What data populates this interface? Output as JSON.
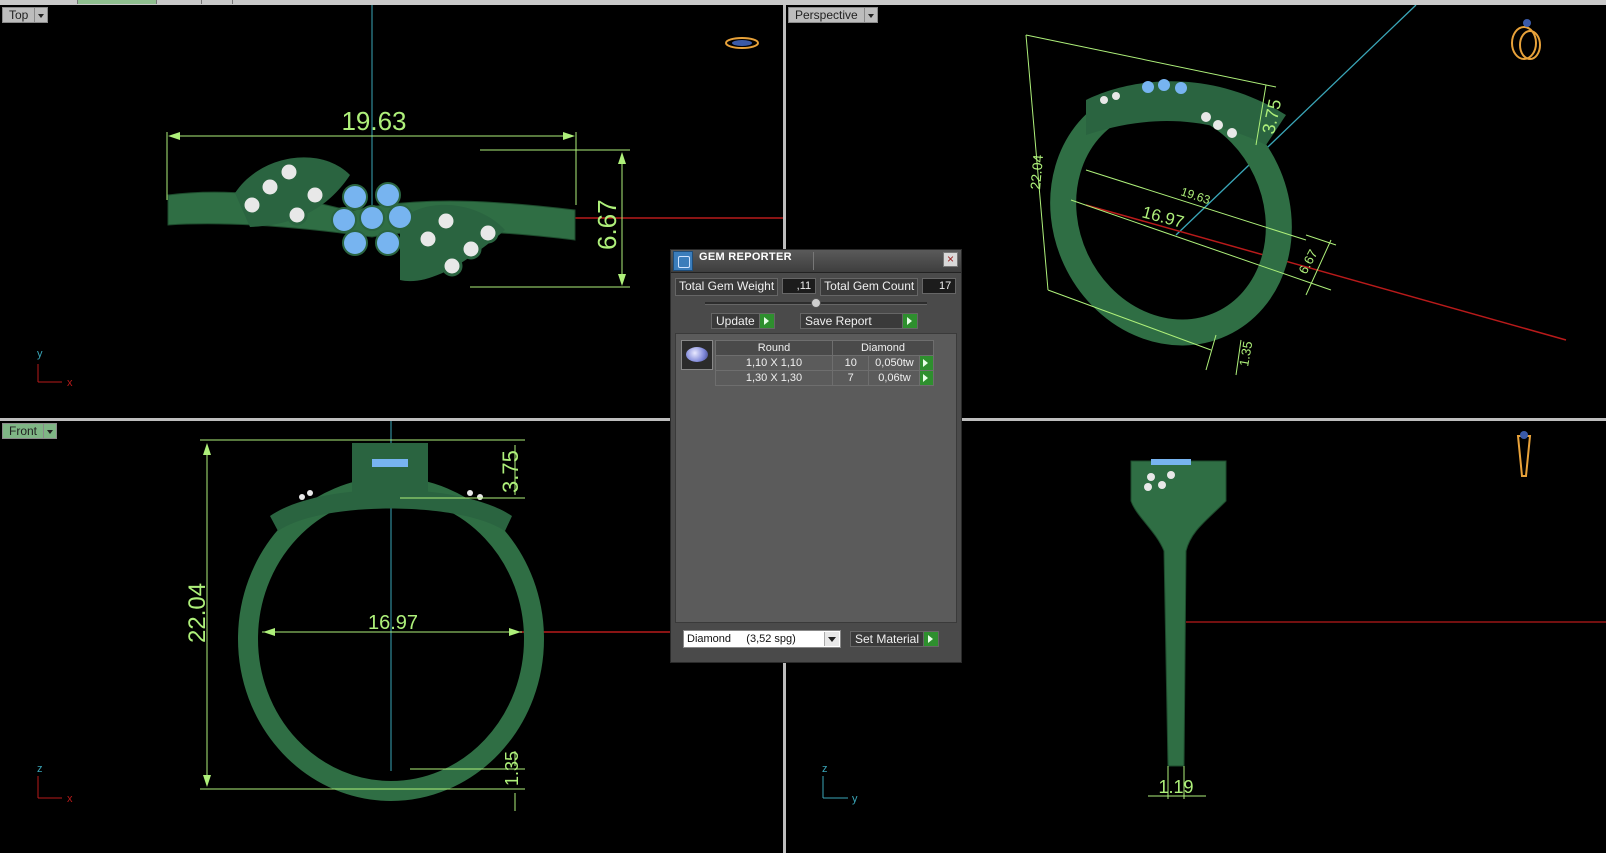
{
  "viewports": {
    "top": {
      "label": "Top",
      "dims": [
        "19.63",
        "6.67"
      ],
      "axes": [
        "y",
        "x"
      ]
    },
    "perspective": {
      "label": "Perspective",
      "dims": [
        "3.75",
        "22.04",
        "19.63",
        "16.97",
        "6.67",
        "1.35"
      ]
    },
    "front": {
      "label": "Front",
      "dims": [
        "3.75",
        "22.04",
        "16.97",
        "1.35"
      ],
      "axes": [
        "z",
        "x"
      ]
    },
    "right": {
      "label": "",
      "dims": [
        "1.19"
      ],
      "axes": [
        "z",
        "y"
      ]
    }
  },
  "gem_reporter": {
    "title": "GEM REPORTER",
    "close": "×",
    "total_weight_label": "Total Gem Weight",
    "total_weight_value": ",11",
    "total_count_label": "Total Gem Count",
    "total_count_value": "17",
    "update_label": "Update",
    "save_report_label": "Save Report",
    "table": {
      "headers": [
        "Round",
        "Diamond"
      ],
      "rows": [
        {
          "size": "1,10 X 1,10",
          "count": "10",
          "weight": "0,050tw"
        },
        {
          "size": "1,30 X 1,30",
          "count": "7",
          "weight": "0,06tw"
        }
      ]
    },
    "material_select": "Diamond     (3,52 spg)",
    "set_material_label": "Set Material"
  },
  "colors": {
    "dimension": "#aef07a",
    "ring": "#2f6e44",
    "gem_blue": "#77b4f0",
    "x_axis": "#b81a1a",
    "y_axis": "#3aa6b8"
  }
}
